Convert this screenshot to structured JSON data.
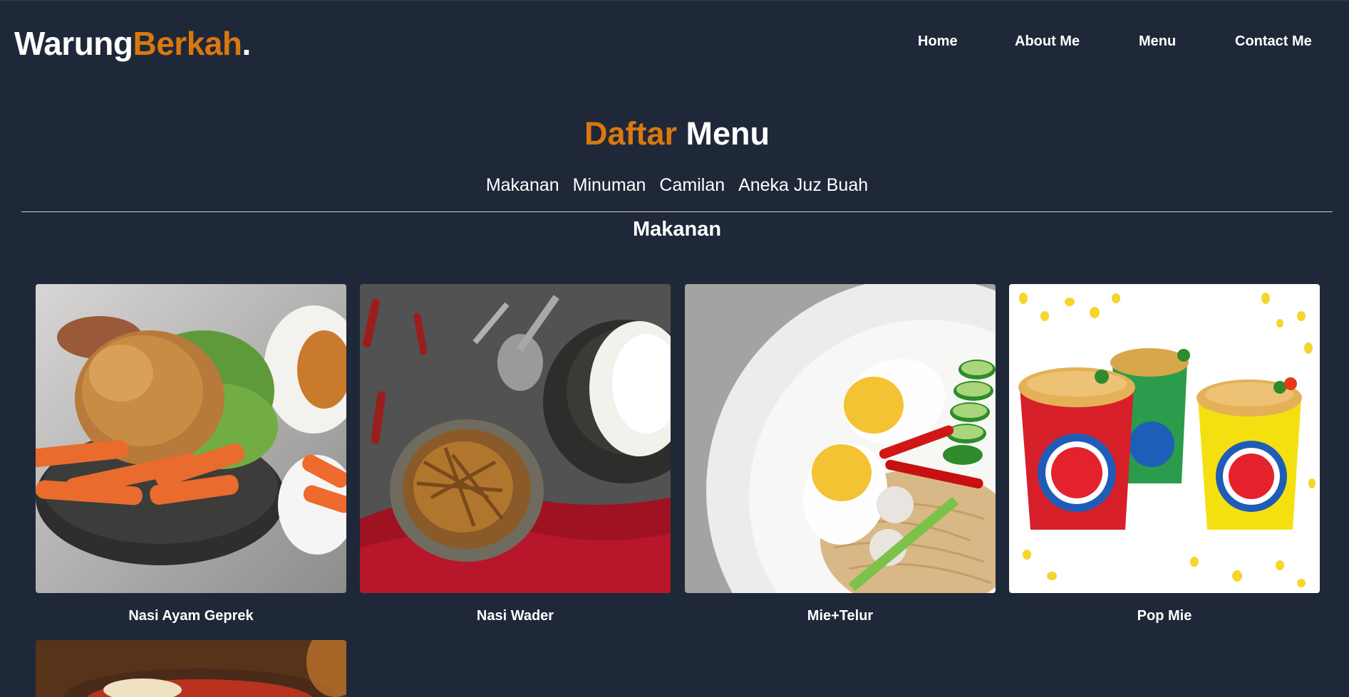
{
  "logo": {
    "part1": "Warung",
    "part2": "Berkah",
    "dot": "."
  },
  "nav": {
    "home": "Home",
    "about": "About Me",
    "menu": "Menu",
    "contact": "Contact Me"
  },
  "heading": {
    "orange": "Daftar",
    "white": "Menu"
  },
  "categories": [
    "Makanan",
    "Minuman",
    "Camilan",
    "Aneka Juz Buah"
  ],
  "section_title": "Makanan",
  "items": [
    {
      "name": "Nasi Ayam Geprek"
    },
    {
      "name": "Nasi Wader"
    },
    {
      "name": "Mie+Telur"
    },
    {
      "name": "Pop Mie"
    }
  ],
  "colors": {
    "background": "#1f2838",
    "accent": "#d9780f",
    "text": "#ffffff"
  }
}
